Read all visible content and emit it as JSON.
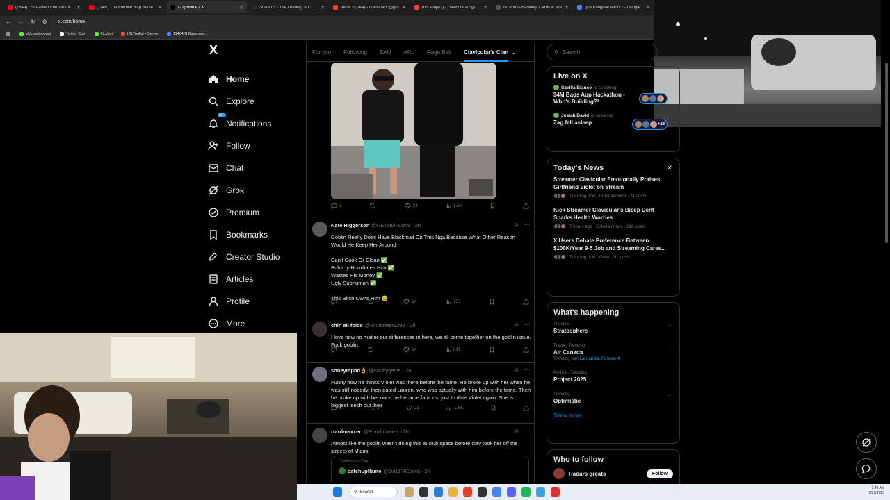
{
  "browser": {
    "tabs": [
      {
        "label": "(1849) I Streamed Fortnite for",
        "color": "#ff0000",
        "active": false
      },
      {
        "label": "(1849) The Fortnite Rap Battle",
        "color": "#ff0000",
        "active": false
      },
      {
        "label": "(21) Home / X",
        "color": "#000000",
        "active": true
      },
      {
        "label": "Stake.us - The Leading Social C",
        "color": "#222f3a",
        "active": false
      },
      {
        "label": "Inbox (9,244) - bradenabc@gm",
        "color": "#ea4335",
        "active": false
      },
      {
        "label": "(no subject) - claviculararlt@gm",
        "color": "#ea4335",
        "active": false
      },
      {
        "label": "Business Banking, Cards & Tea",
        "color": "#555555",
        "active": false
      },
      {
        "label": "quadrangular lefort 2 - Google",
        "color": "#4285f4",
        "active": false
      }
    ],
    "url": "x.com/home",
    "bookmarks": [
      {
        "label": "kick dashboard",
        "color": "#53fc18"
      },
      {
        "label": "Twitter Com",
        "color": "#ffffff"
      },
      {
        "label": "kickbot",
        "color": "#53fc18"
      },
      {
        "label": "IRLToolkit • Server",
        "color": "#e34c26"
      },
      {
        "label": "11404 N Bayshore...",
        "color": "#4285f4"
      }
    ]
  },
  "nav": {
    "logo": "X",
    "notif_badge": "20+",
    "items": [
      {
        "label": "Home",
        "icon": "home-icon"
      },
      {
        "label": "Explore",
        "icon": "search-icon"
      },
      {
        "label": "Notifications",
        "icon": "bell-icon"
      },
      {
        "label": "Follow",
        "icon": "add-user-icon"
      },
      {
        "label": "Chat",
        "icon": "mail-icon"
      },
      {
        "label": "Grok",
        "icon": "grok-icon"
      },
      {
        "label": "Premium",
        "icon": "verified-icon"
      },
      {
        "label": "Bookmarks",
        "icon": "bookmark-icon"
      },
      {
        "label": "Creator Studio",
        "icon": "rocket-icon"
      },
      {
        "label": "Articles",
        "icon": "article-icon"
      },
      {
        "label": "Profile",
        "icon": "person-icon"
      },
      {
        "label": "More",
        "icon": "more-icon"
      }
    ]
  },
  "feed": {
    "tabs": [
      "For you",
      "Following",
      "BAU",
      "ARL",
      "Rage Bait",
      "Clavicular's Clan"
    ],
    "first_post_stats": {
      "replies": "1",
      "reposts": "",
      "likes": "24",
      "views": "1.5K"
    },
    "posts": [
      {
        "name": "Nate Higgerson",
        "handle": "@RETRØFLØW · 2h",
        "body": "Goblin Really Does Have Blackmail On This Nga Because What Other Reason Would He Keep Her Around\n\nCan't Cook Or Clean ✅\nPublicly Humiliates Him ✅\nWastes His Money ✅\nUgly Subhuman ✅\n\nThis Bitch Owns Him 😏",
        "replies": "",
        "reposts": "",
        "likes": "24",
        "views": "757"
      },
      {
        "name": "chin all folds",
        "handle": "@chudeater9292 · 2h",
        "body": "I love how no matter our differences in here, we all come together on the goblin issue. Fuck goblin.",
        "replies": "",
        "reposts": "",
        "likes": "24",
        "views": "619"
      },
      {
        "name": "soneympnd👌",
        "handle": "@soneygems · 2h",
        "body": "Funny how he thinks Violet was there before the fame. He broke up with her when he was still nobody, then dated Lauren, who was actually with him before the fame. Then he broke up with her once he became famous, just to date Violet again. She is biggest leesh out their",
        "replies": "1",
        "reposts": "2",
        "likes": "23",
        "views": "1.6K"
      },
      {
        "name": "rtardmaxxer",
        "handle": "@Rtardmaxxer · 2h",
        "body": "Almost like the goblin wasn't doing this at club space before clav took her off the streets of Miami",
        "replies": "",
        "reposts": "",
        "likes": "",
        "views": ""
      }
    ],
    "quote": {
      "community": "Clavicular's Clan",
      "name": "catchupflame",
      "handle": "@Da1179David · 2h"
    }
  },
  "sidebar": {
    "search_placeholder": "Search",
    "live": {
      "title": "Live on X",
      "spaces": [
        {
          "host": "Gorilla Blanco",
          "status": "is speaking",
          "title": "$4M Bags App Hackathon - Who's Building?!",
          "extra": ""
        },
        {
          "host": "Josiah David",
          "status": "is speaking",
          "title": "Zag fell asleep",
          "extra": "+22"
        }
      ]
    },
    "news": {
      "title": "Today's News",
      "items": [
        {
          "headline": "Streamer Clavicular Emotionally Praises Girlfriend Violet on Stream",
          "meta": "Trending now · Entertainment · 24 posts"
        },
        {
          "headline": "Kick Streamer Clavicular's Bicep Dent Sparks Health Worries",
          "meta": "7 hours ago · Entertainment · 210 posts"
        },
        {
          "headline": "X Users Debate Preference Between $100K/Year 9-5 Job and Streaming Caree...",
          "meta": "Trending now · Other · 51 posts"
        }
      ]
    },
    "happening": {
      "title": "What's happening",
      "trends": [
        {
          "category": "Trending",
          "name": "Stratosphere",
          "with": "",
          "with_links": ""
        },
        {
          "category": "Travel · Trending",
          "name": "Air Canada",
          "with": "Trending with",
          "with_links": "LaGuardia, Runway 4"
        },
        {
          "category": "Politics · Trending",
          "name": "Project 2025",
          "with": "",
          "with_links": ""
        },
        {
          "category": "Trending",
          "name": "Optimistic",
          "with": "",
          "with_links": ""
        }
      ],
      "show_more": "Show more"
    },
    "who_to_follow": {
      "title": "Who to follow",
      "first": {
        "name": "Radars greats",
        "button": "Follow"
      }
    }
  },
  "taskbar": {
    "search_label": "Search",
    "time": "3:40 AM",
    "date": "5/23/2025"
  },
  "colors": {
    "accent": "#1d9bf0",
    "background": "#000000",
    "border": "#2f3336",
    "muted": "#71767b"
  }
}
